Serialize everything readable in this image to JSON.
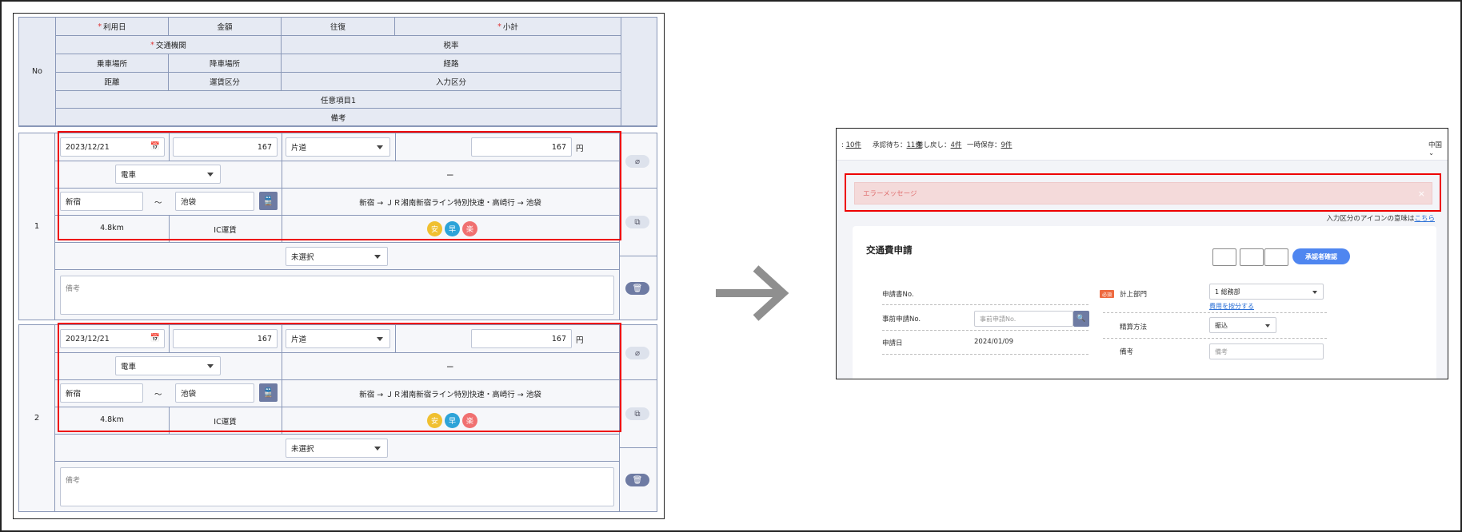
{
  "left": {
    "header": {
      "no": "No",
      "usage_date": "利用日",
      "amount": "金額",
      "round_trip": "往復",
      "subtotal": "小計",
      "transport": "交通機関",
      "tax_rate": "税率",
      "board_place": "乗車場所",
      "alight_place": "降車場所",
      "route": "経路",
      "distance": "距離",
      "fare_type": "運賃区分",
      "input_type": "入力区分",
      "optional_item": "任意項目1",
      "remarks": "備考",
      "required_mark": "*"
    },
    "rows": [
      {
        "no": "1",
        "date": "2023/12/21",
        "amount": "167",
        "trip": "片道",
        "subtotal": "167",
        "yen": "円",
        "transport": "電車",
        "tax": "ー",
        "from": "新宿",
        "tilde": "〜",
        "to": "池袋",
        "route": "新宿 → ＪＲ湘南新宿ライン特別快速・高崎行 → 池袋",
        "distance": "4.8km",
        "fare": "IC運賃",
        "badges": [
          "安",
          "早",
          "楽"
        ],
        "optional": "未選択",
        "memo_placeholder": "備考"
      },
      {
        "no": "2",
        "date": "2023/12/21",
        "amount": "167",
        "trip": "片道",
        "subtotal": "167",
        "yen": "円",
        "transport": "電車",
        "tax": "ー",
        "from": "新宿",
        "tilde": "〜",
        "to": "池袋",
        "route": "新宿 → ＪＲ湘南新宿ライン特別快速・高崎行 → 池袋",
        "distance": "4.8km",
        "fare": "IC運賃",
        "badges": [
          "安",
          "早",
          "楽"
        ],
        "optional": "未選択",
        "memo_placeholder": "備考"
      }
    ],
    "badge_colors": [
      "#f0c030",
      "#2da3d8",
      "#f07070"
    ],
    "accent_red": "#e00000"
  },
  "right": {
    "topbar": {
      "c1_num": "10件",
      "c2_label": "承認待ち：",
      "c2_num": "11件",
      "c3_label": "差し戻し：",
      "c3_num": "4件",
      "c4_label": "一時保存：",
      "c4_num": "9件",
      "lang": "中国"
    },
    "error_message": "エラーメッセージ",
    "close_glyph": "×",
    "note_text": "入力区分のアイコンの意味は",
    "note_link": "こちら",
    "card_title": "交通費申請",
    "approver_button": "承認者確認",
    "fields": {
      "app_no": "申請書No.",
      "pre_app_no": "事前申請No.",
      "pre_app_placeholder": "事前申請No.",
      "app_date": "申請日",
      "app_date_value": "2024/01/09",
      "required_tag": "必須",
      "dept_label": "計上部門",
      "dept_value": "1 総務部",
      "split_link": "費用を按分する",
      "settle_label": "精算方法",
      "settle_value": "振込",
      "remarks_label": "備考",
      "remarks_placeholder": "備考"
    },
    "primary_color": "#4f86f0"
  }
}
